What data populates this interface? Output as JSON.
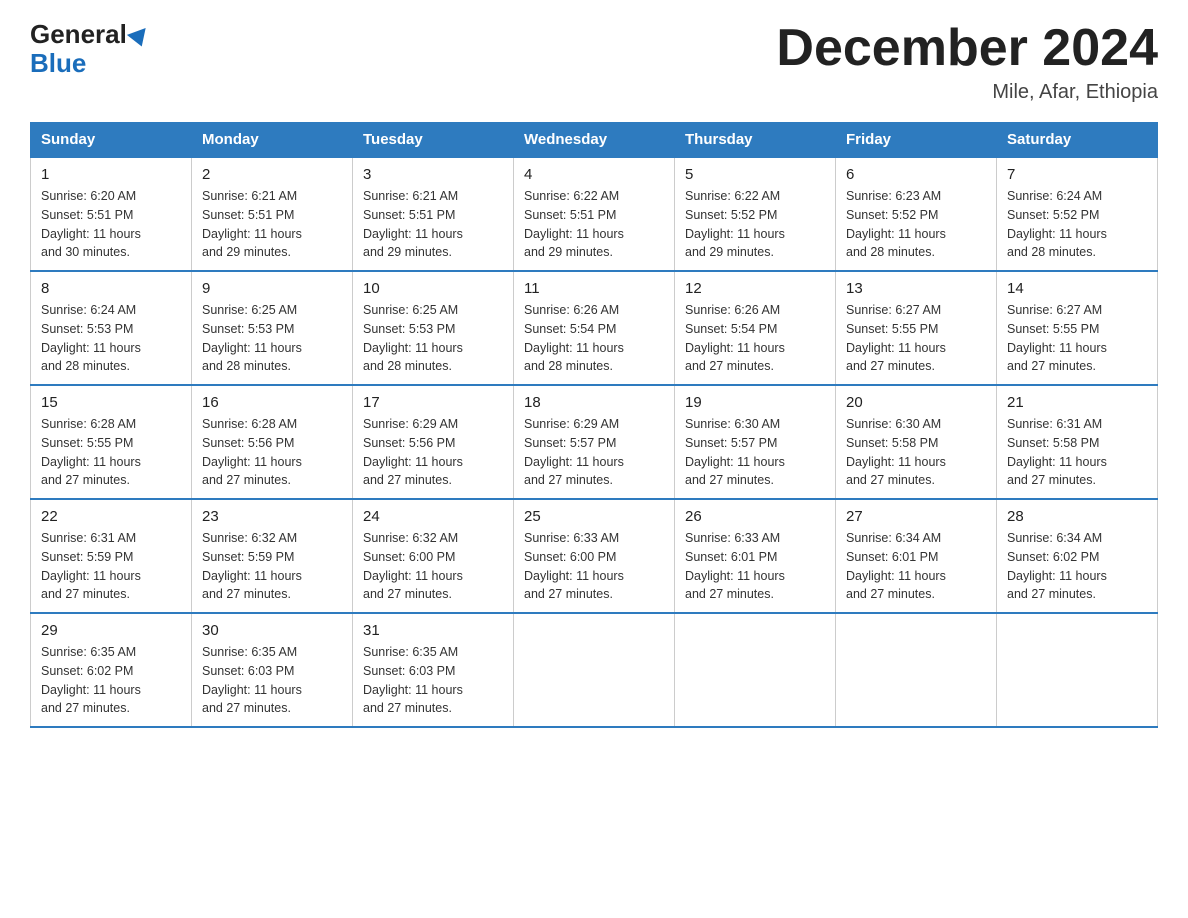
{
  "header": {
    "logo_general": "General",
    "logo_blue": "Blue",
    "month_title": "December 2024",
    "location": "Mile, Afar, Ethiopia"
  },
  "days_of_week": [
    "Sunday",
    "Monday",
    "Tuesday",
    "Wednesday",
    "Thursday",
    "Friday",
    "Saturday"
  ],
  "weeks": [
    [
      {
        "day": "1",
        "sunrise": "6:20 AM",
        "sunset": "5:51 PM",
        "daylight": "11 hours and 30 minutes."
      },
      {
        "day": "2",
        "sunrise": "6:21 AM",
        "sunset": "5:51 PM",
        "daylight": "11 hours and 29 minutes."
      },
      {
        "day": "3",
        "sunrise": "6:21 AM",
        "sunset": "5:51 PM",
        "daylight": "11 hours and 29 minutes."
      },
      {
        "day": "4",
        "sunrise": "6:22 AM",
        "sunset": "5:51 PM",
        "daylight": "11 hours and 29 minutes."
      },
      {
        "day": "5",
        "sunrise": "6:22 AM",
        "sunset": "5:52 PM",
        "daylight": "11 hours and 29 minutes."
      },
      {
        "day": "6",
        "sunrise": "6:23 AM",
        "sunset": "5:52 PM",
        "daylight": "11 hours and 28 minutes."
      },
      {
        "day": "7",
        "sunrise": "6:24 AM",
        "sunset": "5:52 PM",
        "daylight": "11 hours and 28 minutes."
      }
    ],
    [
      {
        "day": "8",
        "sunrise": "6:24 AM",
        "sunset": "5:53 PM",
        "daylight": "11 hours and 28 minutes."
      },
      {
        "day": "9",
        "sunrise": "6:25 AM",
        "sunset": "5:53 PM",
        "daylight": "11 hours and 28 minutes."
      },
      {
        "day": "10",
        "sunrise": "6:25 AM",
        "sunset": "5:53 PM",
        "daylight": "11 hours and 28 minutes."
      },
      {
        "day": "11",
        "sunrise": "6:26 AM",
        "sunset": "5:54 PM",
        "daylight": "11 hours and 28 minutes."
      },
      {
        "day": "12",
        "sunrise": "6:26 AM",
        "sunset": "5:54 PM",
        "daylight": "11 hours and 27 minutes."
      },
      {
        "day": "13",
        "sunrise": "6:27 AM",
        "sunset": "5:55 PM",
        "daylight": "11 hours and 27 minutes."
      },
      {
        "day": "14",
        "sunrise": "6:27 AM",
        "sunset": "5:55 PM",
        "daylight": "11 hours and 27 minutes."
      }
    ],
    [
      {
        "day": "15",
        "sunrise": "6:28 AM",
        "sunset": "5:55 PM",
        "daylight": "11 hours and 27 minutes."
      },
      {
        "day": "16",
        "sunrise": "6:28 AM",
        "sunset": "5:56 PM",
        "daylight": "11 hours and 27 minutes."
      },
      {
        "day": "17",
        "sunrise": "6:29 AM",
        "sunset": "5:56 PM",
        "daylight": "11 hours and 27 minutes."
      },
      {
        "day": "18",
        "sunrise": "6:29 AM",
        "sunset": "5:57 PM",
        "daylight": "11 hours and 27 minutes."
      },
      {
        "day": "19",
        "sunrise": "6:30 AM",
        "sunset": "5:57 PM",
        "daylight": "11 hours and 27 minutes."
      },
      {
        "day": "20",
        "sunrise": "6:30 AM",
        "sunset": "5:58 PM",
        "daylight": "11 hours and 27 minutes."
      },
      {
        "day": "21",
        "sunrise": "6:31 AM",
        "sunset": "5:58 PM",
        "daylight": "11 hours and 27 minutes."
      }
    ],
    [
      {
        "day": "22",
        "sunrise": "6:31 AM",
        "sunset": "5:59 PM",
        "daylight": "11 hours and 27 minutes."
      },
      {
        "day": "23",
        "sunrise": "6:32 AM",
        "sunset": "5:59 PM",
        "daylight": "11 hours and 27 minutes."
      },
      {
        "day": "24",
        "sunrise": "6:32 AM",
        "sunset": "6:00 PM",
        "daylight": "11 hours and 27 minutes."
      },
      {
        "day": "25",
        "sunrise": "6:33 AM",
        "sunset": "6:00 PM",
        "daylight": "11 hours and 27 minutes."
      },
      {
        "day": "26",
        "sunrise": "6:33 AM",
        "sunset": "6:01 PM",
        "daylight": "11 hours and 27 minutes."
      },
      {
        "day": "27",
        "sunrise": "6:34 AM",
        "sunset": "6:01 PM",
        "daylight": "11 hours and 27 minutes."
      },
      {
        "day": "28",
        "sunrise": "6:34 AM",
        "sunset": "6:02 PM",
        "daylight": "11 hours and 27 minutes."
      }
    ],
    [
      {
        "day": "29",
        "sunrise": "6:35 AM",
        "sunset": "6:02 PM",
        "daylight": "11 hours and 27 minutes."
      },
      {
        "day": "30",
        "sunrise": "6:35 AM",
        "sunset": "6:03 PM",
        "daylight": "11 hours and 27 minutes."
      },
      {
        "day": "31",
        "sunrise": "6:35 AM",
        "sunset": "6:03 PM",
        "daylight": "11 hours and 27 minutes."
      },
      null,
      null,
      null,
      null
    ]
  ],
  "labels": {
    "sunrise": "Sunrise:",
    "sunset": "Sunset:",
    "daylight": "Daylight:"
  }
}
